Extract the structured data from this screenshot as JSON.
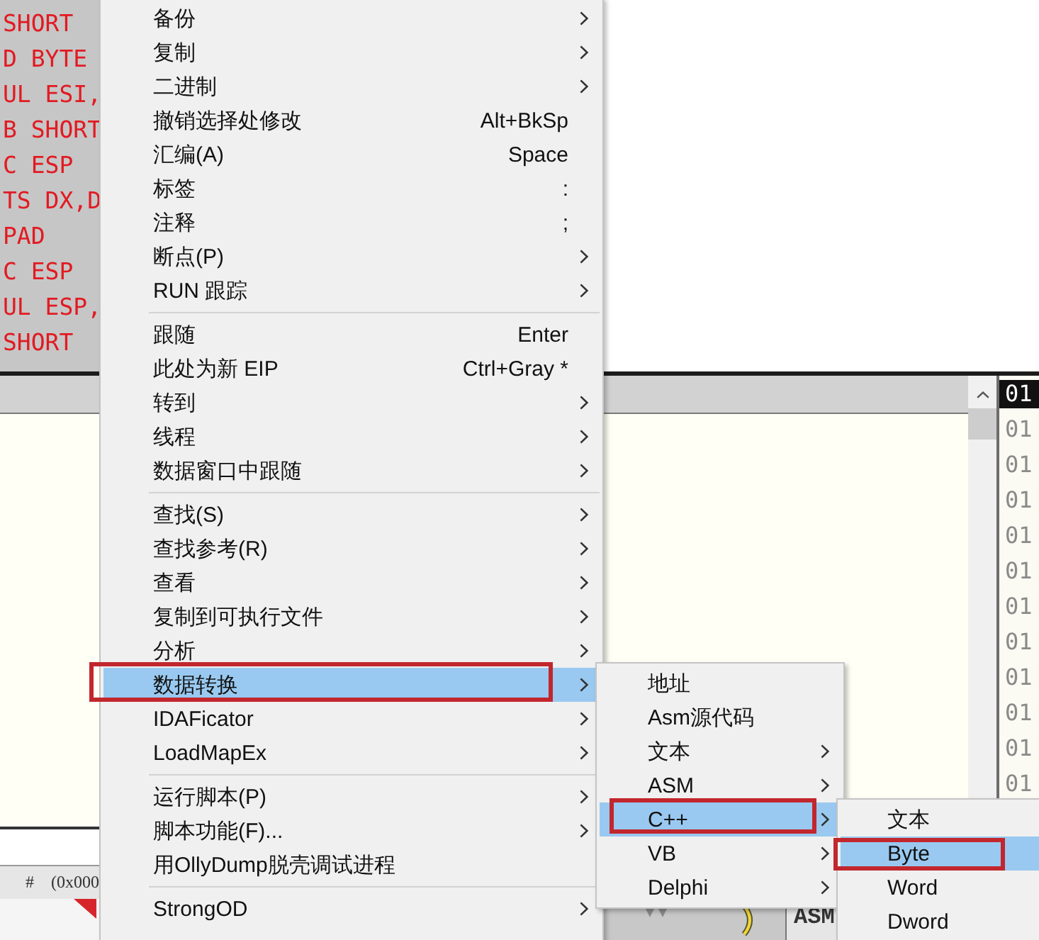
{
  "code_pane": {
    "lines": [
      "SHORT",
      "D BYTE",
      "UL ESI,",
      "B SHORT",
      "C ESP",
      "TS DX,D",
      "PAD",
      "C ESP",
      "UL ESP,",
      "SHORT"
    ]
  },
  "dump_column": {
    "rows": [
      {
        "text": "01",
        "selected": true
      },
      {
        "text": "01",
        "selected": false
      },
      {
        "text": "01",
        "selected": false
      },
      {
        "text": "01",
        "selected": false
      },
      {
        "text": "01",
        "selected": false
      },
      {
        "text": "01",
        "selected": false
      },
      {
        "text": "01",
        "selected": false
      },
      {
        "text": "01",
        "selected": false
      },
      {
        "text": "01",
        "selected": false
      },
      {
        "text": "01",
        "selected": false
      },
      {
        "text": "01",
        "selected": false
      },
      {
        "text": "01",
        "selected": false
      }
    ]
  },
  "status_bar": {
    "items": [
      "#",
      "(0x000"
    ]
  },
  "bottom_toolbar": {
    "label": "ASM"
  },
  "context_menu": {
    "sections": [
      {
        "items": [
          {
            "label": "备份",
            "has_submenu": true,
            "selected": false,
            "annotated": false
          },
          {
            "label": "复制",
            "has_submenu": true,
            "selected": false,
            "annotated": false
          },
          {
            "label": "二进制",
            "has_submenu": true,
            "selected": false,
            "annotated": false
          },
          {
            "label": "撤销选择处修改",
            "shortcut": "Alt+BkSp",
            "has_submenu": false,
            "selected": false,
            "annotated": false
          },
          {
            "label": "汇编(A)",
            "shortcut": "Space",
            "has_submenu": false,
            "selected": false,
            "annotated": false
          },
          {
            "label": "标签",
            "shortcut": ":",
            "has_submenu": false,
            "selected": false,
            "annotated": false
          },
          {
            "label": "注释",
            "shortcut": ";",
            "has_submenu": false,
            "selected": false,
            "annotated": false
          },
          {
            "label": "断点(P)",
            "has_submenu": true,
            "selected": false,
            "annotated": false
          },
          {
            "label": "RUN 跟踪",
            "has_submenu": true,
            "selected": false,
            "annotated": false
          }
        ]
      },
      {
        "items": [
          {
            "label": "跟随",
            "shortcut": "Enter",
            "has_submenu": false,
            "selected": false,
            "annotated": false
          },
          {
            "label": "此处为新 EIP",
            "shortcut": "Ctrl+Gray *",
            "has_submenu": false,
            "selected": false,
            "annotated": false
          },
          {
            "label": "转到",
            "has_submenu": true,
            "selected": false,
            "annotated": false
          },
          {
            "label": "线程",
            "has_submenu": true,
            "selected": false,
            "annotated": false
          },
          {
            "label": "数据窗口中跟随",
            "has_submenu": true,
            "selected": false,
            "annotated": false
          }
        ]
      },
      {
        "items": [
          {
            "label": "查找(S)",
            "has_submenu": true,
            "selected": false,
            "annotated": false
          },
          {
            "label": "查找参考(R)",
            "has_submenu": true,
            "selected": false,
            "annotated": false
          },
          {
            "label": "查看",
            "has_submenu": true,
            "selected": false,
            "annotated": false
          },
          {
            "label": "复制到可执行文件",
            "has_submenu": true,
            "selected": false,
            "annotated": false
          },
          {
            "label": "分析",
            "has_submenu": true,
            "selected": false,
            "annotated": false
          },
          {
            "label": "数据转换",
            "has_submenu": true,
            "selected": true,
            "annotated": true
          },
          {
            "label": "IDAFicator",
            "has_submenu": true,
            "selected": false,
            "annotated": false
          },
          {
            "label": "LoadMapEx",
            "has_submenu": true,
            "selected": false,
            "annotated": false
          }
        ]
      },
      {
        "items": [
          {
            "label": "运行脚本(P)",
            "has_submenu": true,
            "selected": false,
            "annotated": false
          },
          {
            "label": "脚本功能(F)...",
            "has_submenu": true,
            "selected": false,
            "annotated": false
          },
          {
            "label": "用OllyDump脱壳调试进程",
            "has_submenu": false,
            "selected": false,
            "annotated": false
          }
        ]
      },
      {
        "items": [
          {
            "label": "StrongOD",
            "has_submenu": true,
            "selected": false,
            "annotated": false
          }
        ]
      }
    ]
  },
  "submenu": {
    "items": [
      {
        "label": "地址",
        "has_submenu": false,
        "selected": false,
        "annotated": false
      },
      {
        "label": "Asm源代码",
        "has_submenu": false,
        "selected": false,
        "annotated": false
      },
      {
        "label": "文本",
        "has_submenu": true,
        "selected": false,
        "annotated": false
      },
      {
        "label": "ASM",
        "has_submenu": true,
        "selected": false,
        "annotated": false
      },
      {
        "label": "C++",
        "has_submenu": true,
        "selected": true,
        "annotated": true
      },
      {
        "label": "VB",
        "has_submenu": true,
        "selected": false,
        "annotated": false
      },
      {
        "label": "Delphi",
        "has_submenu": true,
        "selected": false,
        "annotated": false
      }
    ]
  },
  "nested_submenu": {
    "items": [
      {
        "label": "文本",
        "selected": false,
        "annotated": false
      },
      {
        "label": "Byte",
        "selected": true,
        "annotated": true
      },
      {
        "label": "Word",
        "selected": false,
        "annotated": false
      },
      {
        "label": "Dword",
        "selected": false,
        "annotated": false
      }
    ]
  }
}
